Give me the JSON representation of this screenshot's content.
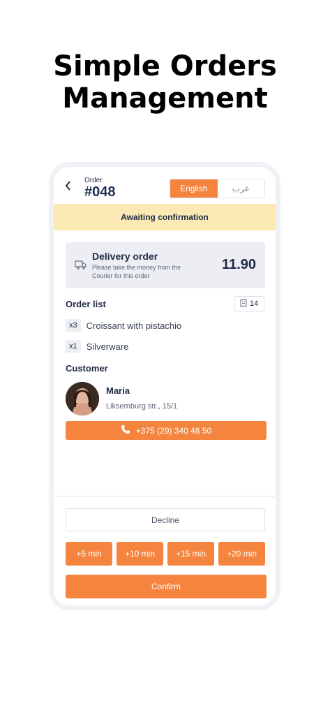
{
  "promo": {
    "headline": "Simple Orders\nManagement"
  },
  "header": {
    "order_label": "Order",
    "order_number": "#048"
  },
  "language": {
    "options": [
      "English",
      "عرب"
    ],
    "selected": "English"
  },
  "status_banner": {
    "text": "Awaiting confirmation",
    "color": "#fbe9b4"
  },
  "delivery": {
    "title": "Delivery order",
    "note": "Please take the money from the Courier for this order",
    "amount": "11.90",
    "icon": "delivery-truck-icon"
  },
  "order_list": {
    "title": "Order list",
    "receipt_count": "14",
    "items": [
      {
        "qty": "x3",
        "name": "Croissant with pistachio"
      },
      {
        "qty": "x1",
        "name": "Silverware"
      }
    ]
  },
  "customer": {
    "section_title": "Customer",
    "name": "Maria",
    "address": "Liksemburg str., 15/1",
    "phone": "+375 (29) 340 48 50"
  },
  "actions": {
    "decline_label": "Decline",
    "time_options": [
      "+5 min",
      "+10 min",
      "+15 min",
      "+20 min"
    ],
    "confirm_label": "Confirm"
  },
  "colors": {
    "accent": "#f5843e",
    "banner": "#fbe9b4",
    "text_dark": "#1f2a44"
  }
}
